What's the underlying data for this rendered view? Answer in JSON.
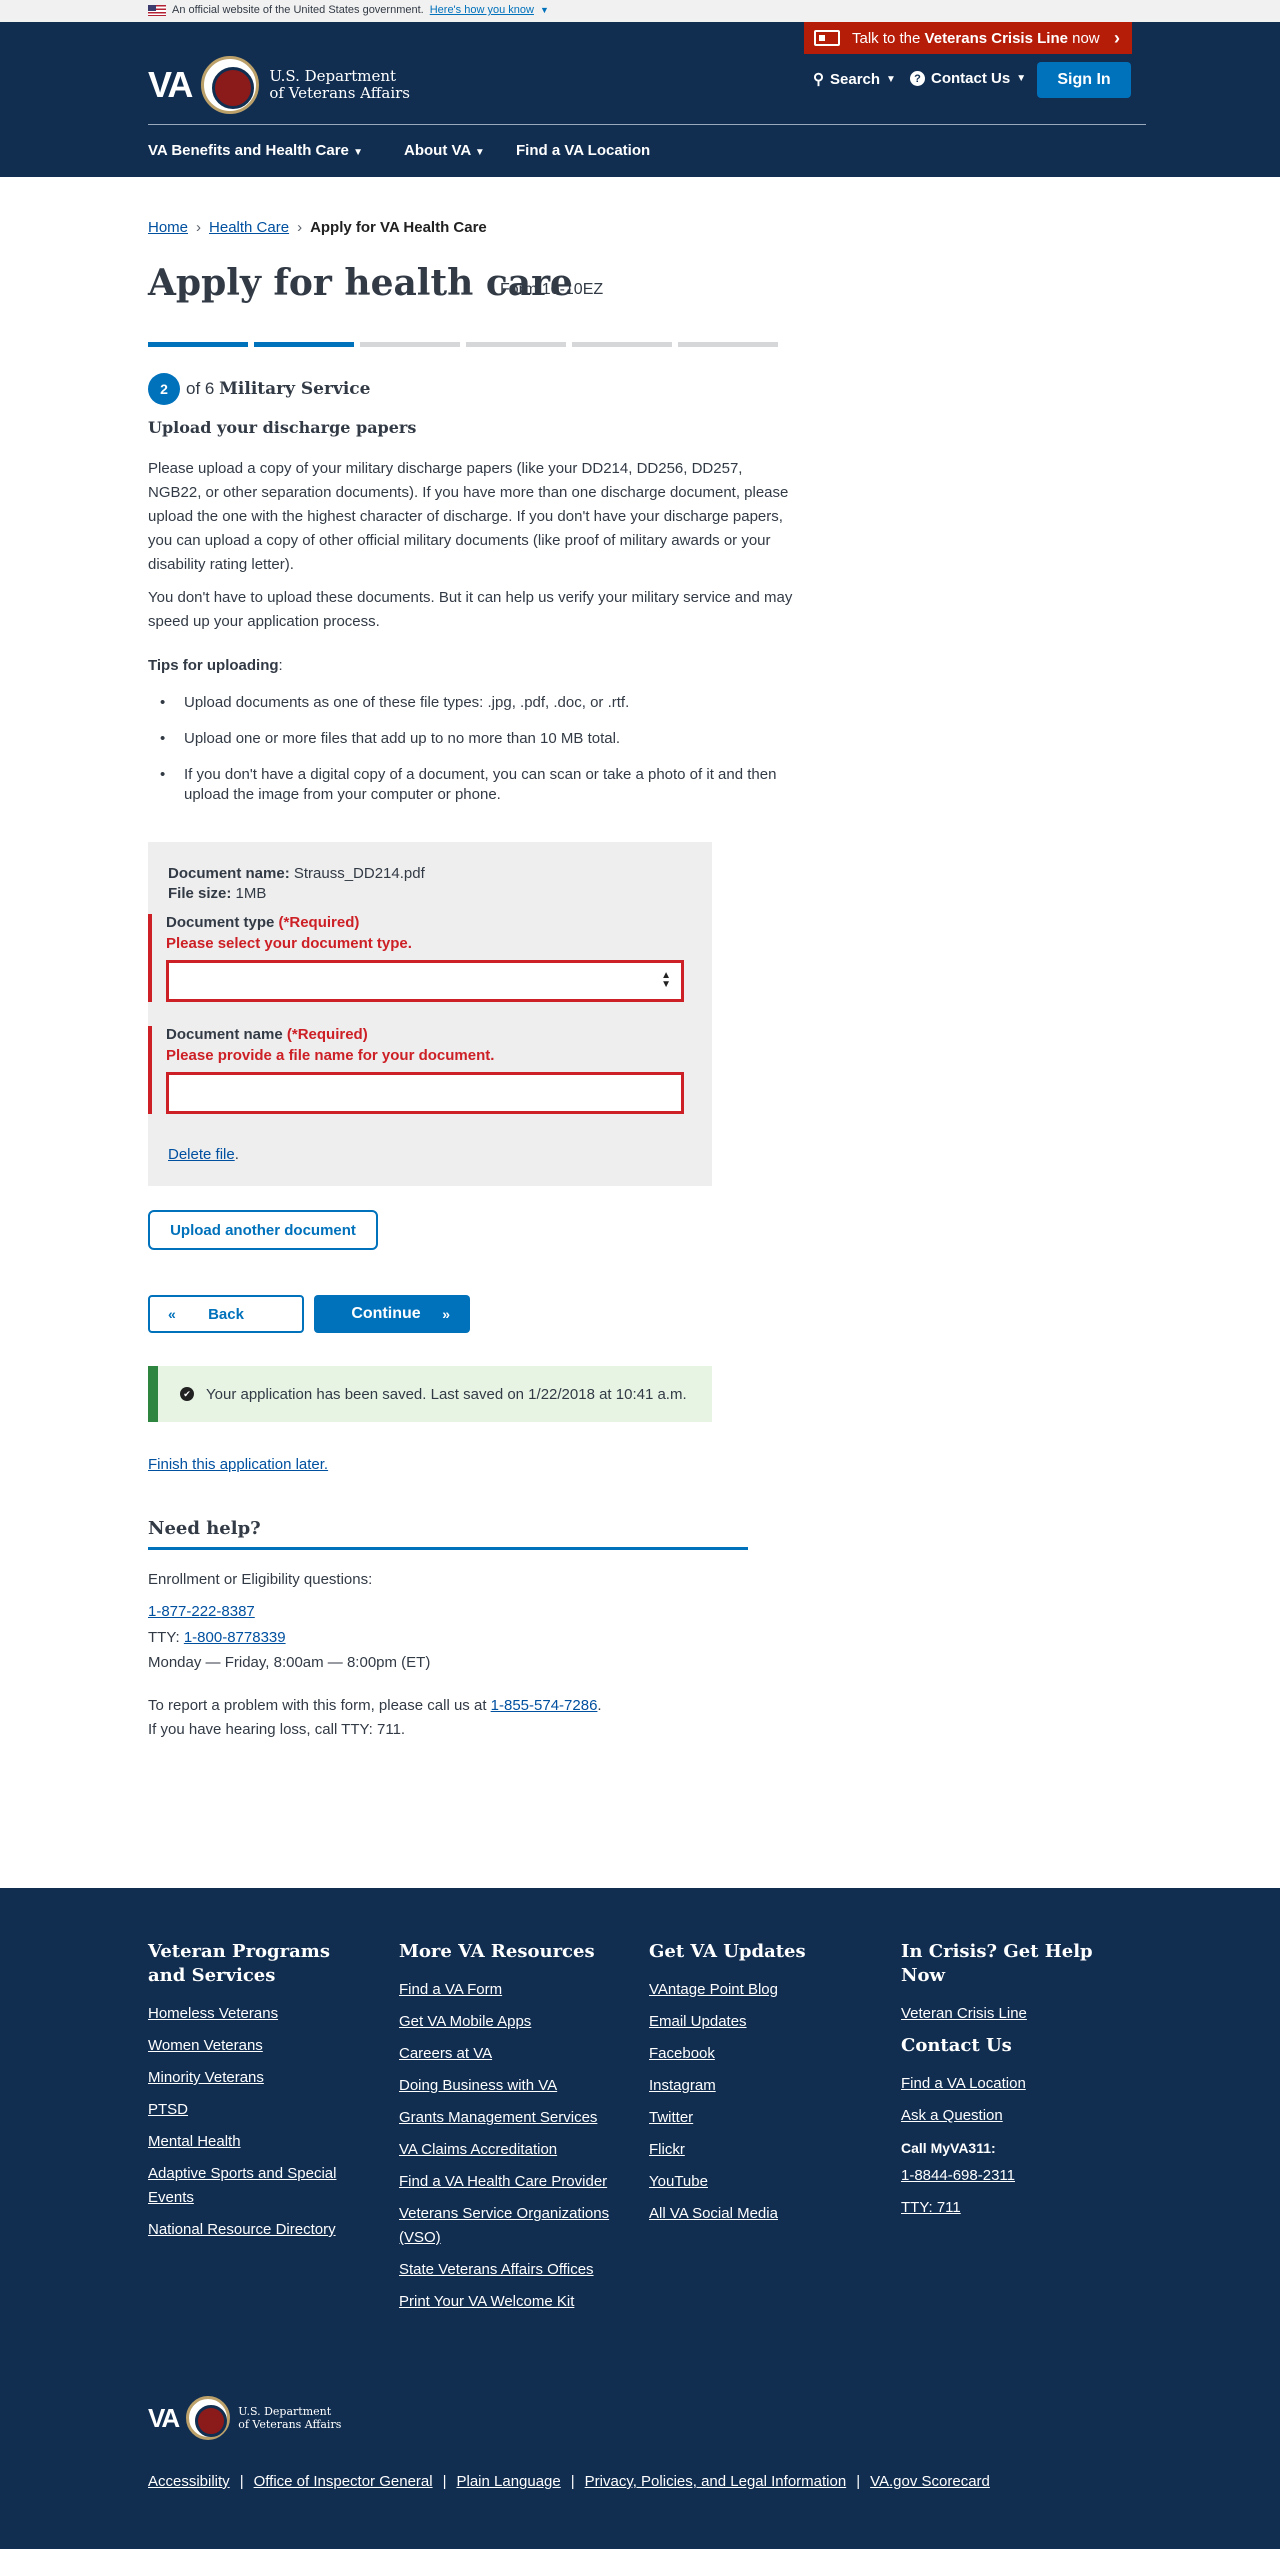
{
  "gov_banner": {
    "text": "An official website of the United States government.",
    "link": "Here's how you know"
  },
  "crisis": {
    "prefix": "Talk to the ",
    "bold": "Veterans Crisis Line",
    "suffix": " now"
  },
  "header": {
    "logo_text": "VA",
    "dept_line1": "U.S. Department",
    "dept_line2": "of Veterans Affairs",
    "search": "Search",
    "contact": "Contact Us",
    "signin": "Sign In",
    "nav": [
      "VA Benefits and Health Care",
      "About VA",
      "Find a VA Location"
    ]
  },
  "breadcrumb": [
    "Home",
    "Health Care",
    "Apply for VA Health Care"
  ],
  "page": {
    "title": "Apply for health care",
    "form_number": "Form 10-10EZ"
  },
  "progress": {
    "current": 2,
    "total": 6,
    "of_text": "of 6",
    "section": "Military Service"
  },
  "content": {
    "heading": "Upload your discharge papers",
    "para1": "Please upload a copy of your military discharge papers (like your DD214, DD256, DD257, NGB22, or other separation documents). If you have more than one discharge document, please upload the one with the highest character of discharge. If you don't have your discharge papers, you can upload a copy of other official military documents (like proof of military awards or your disability rating letter).",
    "para2": "You don't have to upload these documents. But it can help us verify your military service and may speed up your application process.",
    "tips_label": "Tips for uploading",
    "tips": [
      "Upload documents as one of these file types: .jpg, .pdf, .doc, or .rtf.",
      "Upload one or more files that add up to no more than 10 MB total.",
      "If  you don't have a digital copy of a document, you can scan or take a photo of it and then upload the image from your computer or phone."
    ]
  },
  "upload_card": {
    "doc_name_label": "Document name:",
    "doc_name_value": "Strauss_DD214.pdf",
    "file_size_label": "File size:",
    "file_size_value": "1MB",
    "doc_type_label": "Document type",
    "required": "(*Required)",
    "doc_type_error": "Please select your document type.",
    "doc_type_value": "",
    "doc_name_field_label": "Document name",
    "doc_name_error": "Please provide a file name for your document.",
    "doc_name_field_value": "",
    "delete": "Delete file"
  },
  "buttons": {
    "upload_another": "Upload another document",
    "back": "Back",
    "continue": "Continue"
  },
  "saved": {
    "text": "Your application has been saved. Last saved on 1/22/2018 at 10:41 a.m."
  },
  "finish_later": "Finish this application later.",
  "help": {
    "heading": "Need help?",
    "enroll": "Enrollment or Eligibility questions:",
    "phone": "1-877-222-8387",
    "tty_label": "TTY: ",
    "tty": "1-800-8778339",
    "hours": "Monday — Friday, 8:00am — 8:00pm (ET)",
    "report_prefix": "To report a problem with this form, please call us at ",
    "report_phone": "1-855-574-7286",
    "hearing": "If you have hearing loss, call TTY: 711."
  },
  "footer": {
    "col1": {
      "title": "Veteran Programs and Services",
      "links": [
        "Homeless Veterans",
        "Women Veterans",
        "Minority Veterans",
        "PTSD",
        "Mental Health",
        "Adaptive Sports and Special Events",
        "National Resource Directory"
      ]
    },
    "col2": {
      "title": "More VA Resources",
      "links": [
        "Find a VA Form",
        "Get VA Mobile Apps",
        "Careers at VA",
        "Doing Business with VA",
        "Grants Management Services",
        "VA Claims Accreditation",
        "Find a VA Health Care Provider",
        "Veterans Service Organizations (VSO)",
        "State Veterans Affairs Offices",
        "Print Your VA Welcome Kit"
      ]
    },
    "col3": {
      "title": "Get VA Updates",
      "links": [
        "VAntage Point Blog",
        "Email Updates",
        "Facebook",
        "Instagram",
        "Twitter",
        "Flickr",
        "YouTube",
        "All VA Social Media"
      ]
    },
    "col4": {
      "title": "In Crisis? Get Help Now",
      "crisis_link": "Veteran Crisis Line",
      "contact_title": "Contact Us",
      "contact_links": [
        "Find a VA Location",
        "Ask a Question"
      ],
      "call_label": "Call MyVA311:",
      "call_number": "1-8844-698-2311",
      "tty": "TTY: 711"
    },
    "bottom_links": [
      "Accessibility",
      "Office of Inspector General",
      "Plain Language",
      "Privacy, Policies, and Legal Information",
      "VA.gov Scorecard"
    ]
  },
  "colors": {
    "navy": "#112e51",
    "primary": "#0071bb",
    "error": "#cd2026",
    "success": "#2e8540",
    "crisis": "#b51d09"
  }
}
